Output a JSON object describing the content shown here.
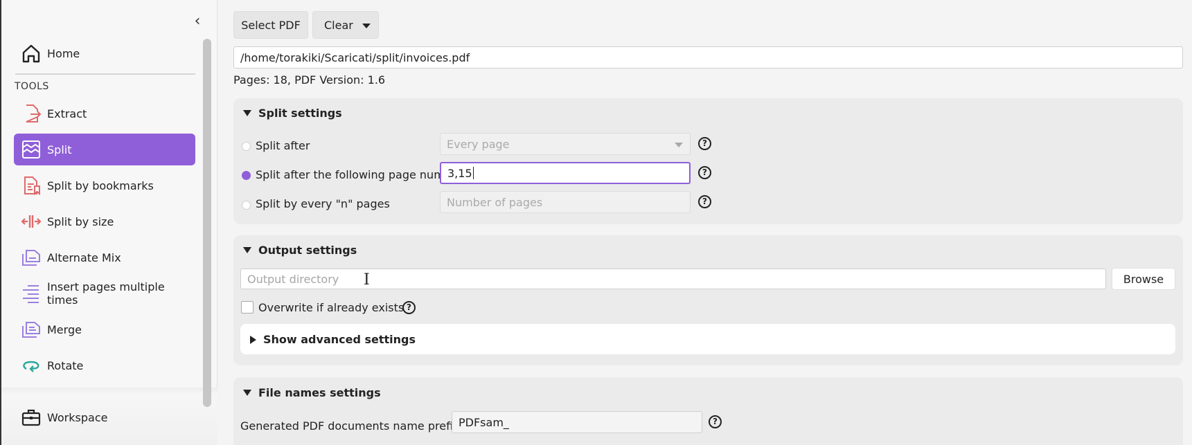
{
  "sidebar": {
    "home_label": "Home",
    "tools_label": "TOOLS",
    "items": [
      {
        "label": "Extract",
        "icon": "extract-icon"
      },
      {
        "label": "Split",
        "icon": "split-icon",
        "active": true
      },
      {
        "label": "Split by bookmarks",
        "icon": "split-bookmarks-icon"
      },
      {
        "label": "Split by size",
        "icon": "split-size-icon"
      },
      {
        "label": "Alternate Mix",
        "icon": "alternate-mix-icon"
      },
      {
        "label": "Insert pages multiple times",
        "icon": "insert-pages-icon"
      },
      {
        "label": "Merge",
        "icon": "merge-icon"
      },
      {
        "label": "Rotate",
        "icon": "rotate-icon"
      }
    ],
    "workspace_label": "Workspace"
  },
  "toolbar": {
    "select_label": "Select PDF",
    "clear_label": "Clear"
  },
  "file": {
    "path": "/home/torakiki/Scaricati/split/invoices.pdf",
    "info": "Pages: 18, PDF Version: 1.6"
  },
  "split_settings": {
    "title": "Split settings",
    "options": [
      {
        "label": "Split after",
        "value": "Every page",
        "selected": false
      },
      {
        "label": "Split after the following page numbers",
        "value": "3,15",
        "selected": true
      },
      {
        "label": "Split by every \"n\" pages",
        "placeholder": "Number of pages",
        "selected": false
      }
    ]
  },
  "output_settings": {
    "title": "Output settings",
    "dir_placeholder": "Output directory",
    "browse_label": "Browse",
    "overwrite_label": "Overwrite if already exists",
    "advanced_label": "Show advanced settings"
  },
  "filenames": {
    "title": "File names settings",
    "prefix_label": "Generated PDF documents name prefix:",
    "prefix_value": "PDFsam_"
  },
  "colors": {
    "accent": "#8f5fd9",
    "icon_pink": "#e06a6a",
    "icon_purple": "#9b7fe0",
    "icon_teal": "#2aa79b"
  }
}
